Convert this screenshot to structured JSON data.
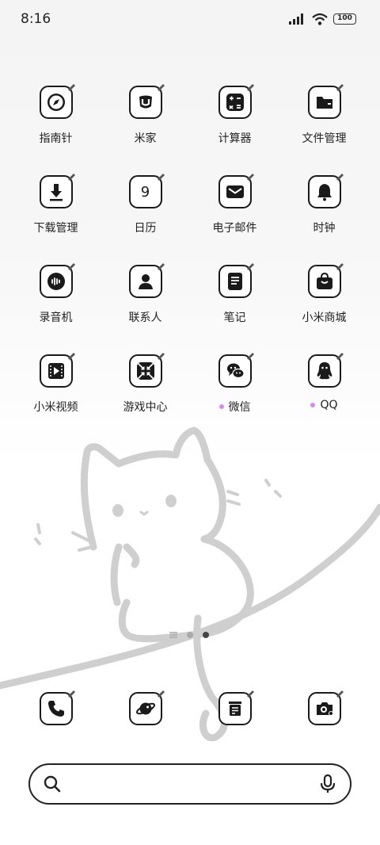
{
  "status_bar": {
    "time": "8:16",
    "battery": "100"
  },
  "apps": [
    {
      "label": "指南针",
      "icon": "compass-icon"
    },
    {
      "label": "米家",
      "icon": "mijia-icon"
    },
    {
      "label": "计算器",
      "icon": "calculator-icon"
    },
    {
      "label": "文件管理",
      "icon": "folder-icon"
    },
    {
      "label": "下载管理",
      "icon": "download-icon"
    },
    {
      "label": "日历",
      "icon": "calendar-icon",
      "glyph": "9"
    },
    {
      "label": "电子邮件",
      "icon": "mail-icon"
    },
    {
      "label": "时钟",
      "icon": "alarm-bell-icon"
    },
    {
      "label": "录音机",
      "icon": "recorder-icon"
    },
    {
      "label": "联系人",
      "icon": "contacts-icon"
    },
    {
      "label": "笔记",
      "icon": "notes-icon"
    },
    {
      "label": "小米商城",
      "icon": "shop-bag-icon"
    },
    {
      "label": "小米视频",
      "icon": "video-icon"
    },
    {
      "label": "游戏中心",
      "icon": "game-icon"
    },
    {
      "label": "微信",
      "icon": "wechat-icon",
      "new": true
    },
    {
      "label": "QQ",
      "icon": "qq-icon",
      "new": true
    }
  ],
  "dock": [
    {
      "name": "phone",
      "icon": "phone-icon"
    },
    {
      "name": "browser",
      "icon": "browser-planet-icon"
    },
    {
      "name": "messages",
      "icon": "messages-icon"
    },
    {
      "name": "camera",
      "icon": "camera-icon"
    }
  ],
  "search": {
    "placeholder": ""
  },
  "colors": {
    "accent_dot": "#d78be8",
    "icon_stroke": "#1a1a1a",
    "wallpaper_line": "#cfcfcf"
  }
}
